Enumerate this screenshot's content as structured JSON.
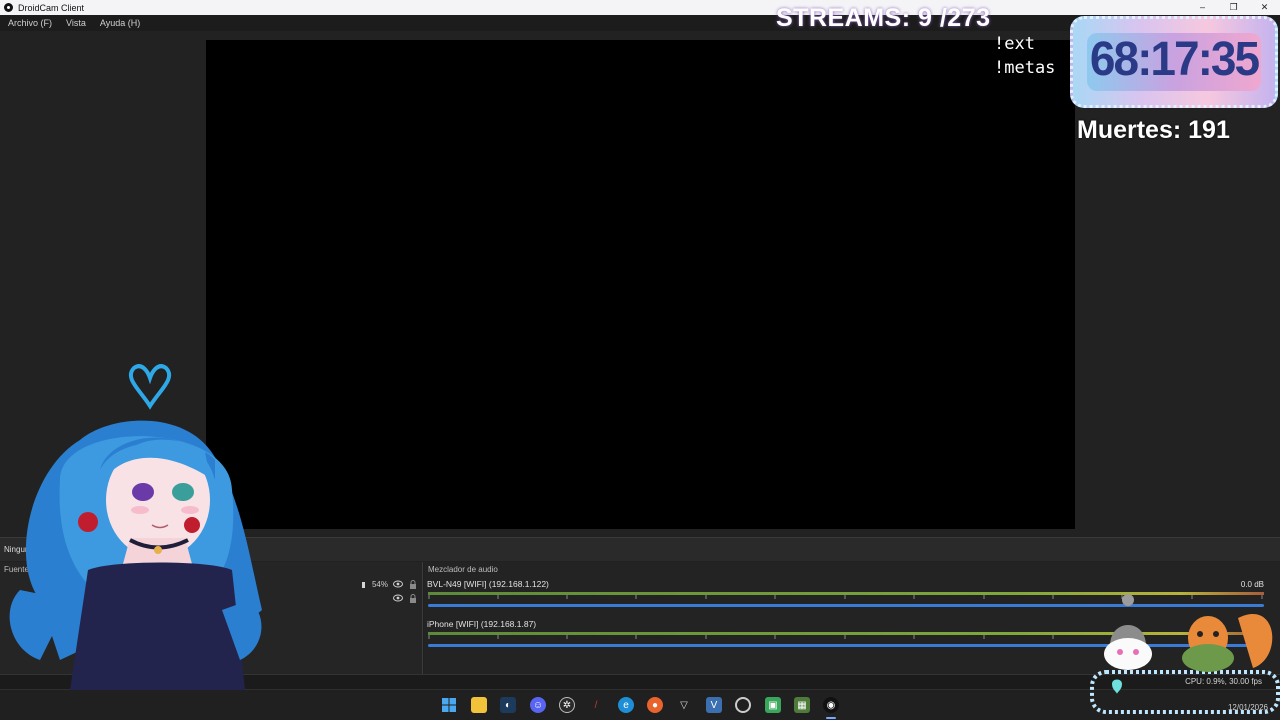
{
  "window": {
    "title": "DroidCam Client",
    "minimize": "–",
    "restore": "❐",
    "close": "✕"
  },
  "menu": {
    "items": [
      "Archivo (F)",
      "Vista",
      "Ayuda (H)"
    ]
  },
  "overlay": {
    "streams": "STREAMS: 9 /273",
    "cmd_ext": "!ext",
    "cmd_metas": "!metas",
    "timer": "68:17:35",
    "deaths": "Muertes: 191"
  },
  "scenes": {
    "label": "Ninguna  ...en"
  },
  "sources": {
    "title": "Fuentes",
    "volume_percent": "54%"
  },
  "mixer": {
    "title": "Mezclador de audio",
    "channels": [
      {
        "name": "BVL-N49 [WIFI] (192.168.1.122)",
        "db": "0.0 dB"
      },
      {
        "name": "iPhone [WIFI] (192.168.1.87)",
        "db": ""
      }
    ]
  },
  "status": {
    "cpu": "CPU: 0.9%, 30.00 fps"
  },
  "taskbar": {
    "date": "12/01/2026",
    "icons": [
      "start-icon",
      "file-explorer-icon",
      "steam-icon",
      "discord-icon",
      "chatgpt-icon",
      "game-icon",
      "edge-icon",
      "firefox-icon",
      "vtube-icon",
      "vscode-icon",
      "obs-icon",
      "app-icon",
      "minecraft-icon",
      "droidcam-icon"
    ]
  },
  "colors": {
    "accent": "#3a7bd5",
    "timer_text": "#2b3a87",
    "canvas": "#000000"
  }
}
